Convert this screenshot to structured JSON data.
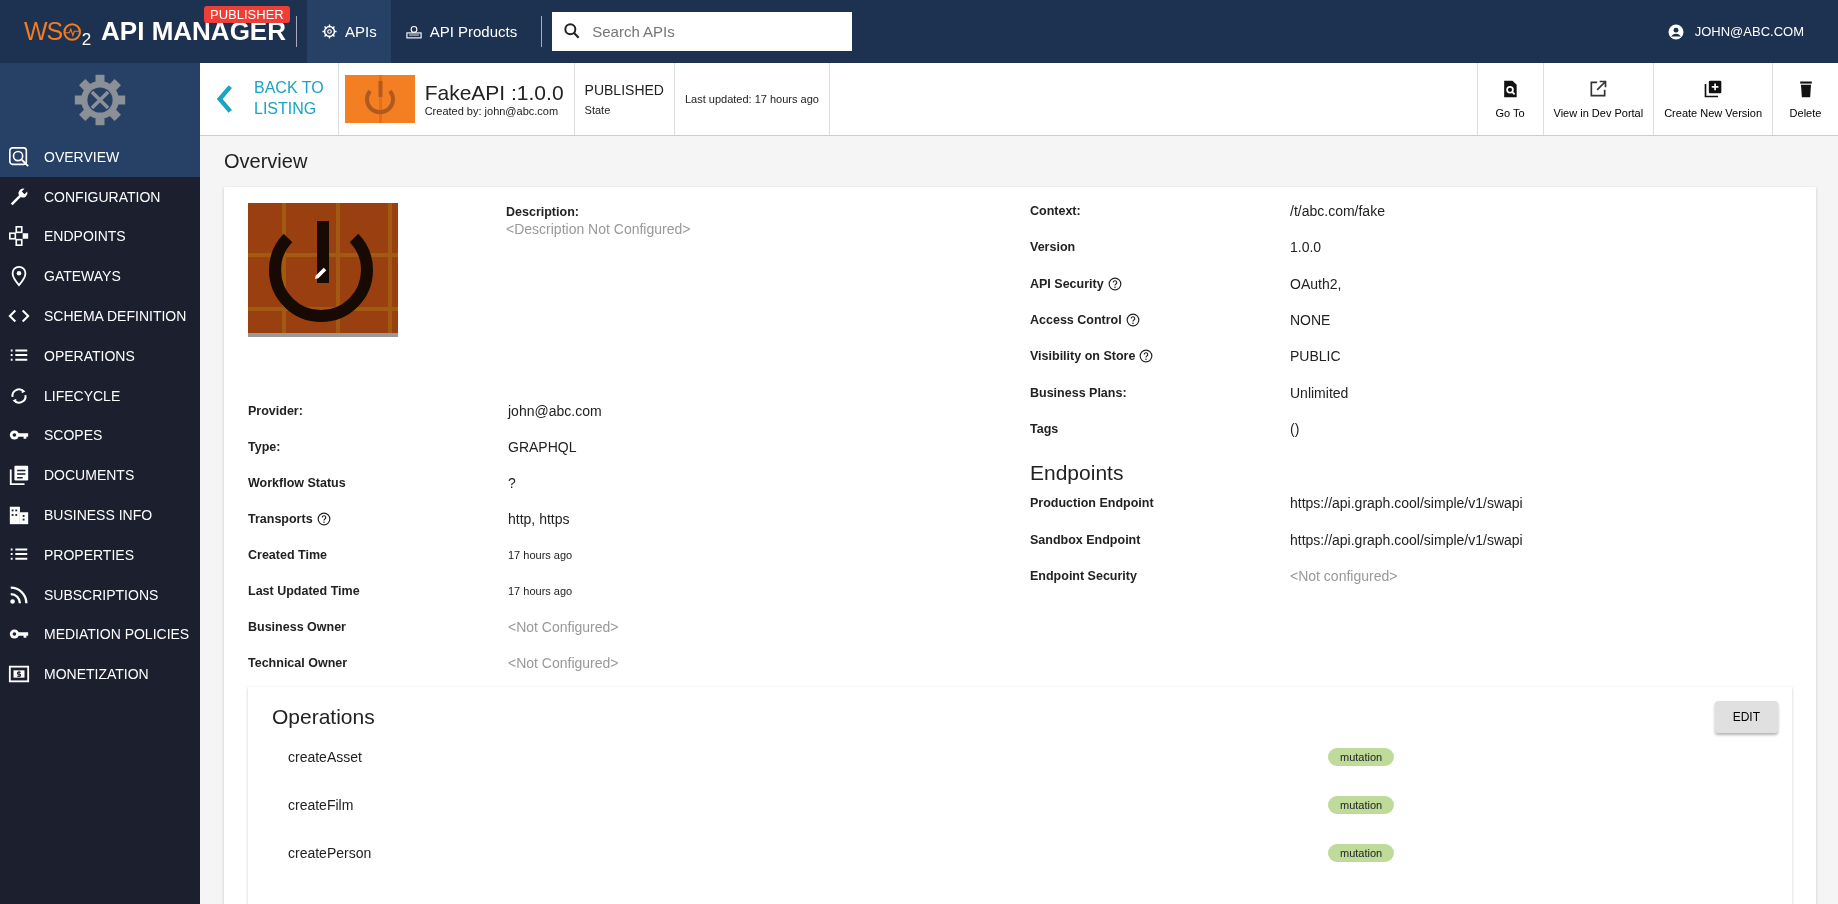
{
  "topbar": {
    "brand": {
      "prefix": "WS",
      "suffix": "2",
      "name": "API MANAGER",
      "badge": "PUBLISHER"
    },
    "nav": [
      {
        "label": "APIs",
        "selected": true
      },
      {
        "label": "API Products",
        "selected": false
      }
    ],
    "search": {
      "placeholder": "Search APIs"
    },
    "user": "JOHN@ABC.COM"
  },
  "sidebar": {
    "items": [
      {
        "label": "OVERVIEW",
        "selected": true
      },
      {
        "label": "CONFIGURATION",
        "selected": false
      },
      {
        "label": "ENDPOINTS",
        "selected": false
      },
      {
        "label": "GATEWAYS",
        "selected": false
      },
      {
        "label": "SCHEMA DEFINITION",
        "selected": false
      },
      {
        "label": "OPERATIONS",
        "selected": false
      },
      {
        "label": "LIFECYCLE",
        "selected": false
      },
      {
        "label": "SCOPES",
        "selected": false
      },
      {
        "label": "DOCUMENTS",
        "selected": false
      },
      {
        "label": "BUSINESS INFO",
        "selected": false
      },
      {
        "label": "PROPERTIES",
        "selected": false
      },
      {
        "label": "SUBSCRIPTIONS",
        "selected": false
      },
      {
        "label": "MEDIATION POLICIES",
        "selected": false
      },
      {
        "label": "MONETIZATION",
        "selected": false
      }
    ]
  },
  "header": {
    "back": [
      "BACK TO",
      "LISTING"
    ],
    "api_name": "FakeAPI :1.0.0",
    "created_by": "Created by: john@abc.com",
    "state": "PUBLISHED",
    "state_label": "State",
    "last_updated": "Last updated: 17 hours ago",
    "actions": [
      {
        "label": "Go To"
      },
      {
        "label": "View in Dev Portal"
      },
      {
        "label": "Create New Version"
      },
      {
        "label": "Delete"
      }
    ]
  },
  "overview": {
    "title": "Overview",
    "description": {
      "label": "Description:",
      "value": "<Description Not Configured>"
    },
    "left_rows": [
      {
        "label": "Provider:",
        "value": "john@abc.com",
        "help": false,
        "kind": "text"
      },
      {
        "label": "Type:",
        "value": "GRAPHQL",
        "help": false,
        "kind": "text"
      },
      {
        "label": "Workflow Status",
        "value": "?",
        "help": false,
        "kind": "text"
      },
      {
        "label": "Transports",
        "value": "http, https",
        "help": true,
        "kind": "text"
      },
      {
        "label": "Created Time",
        "value": "17 hours ago",
        "help": false,
        "kind": "small"
      },
      {
        "label": "Last Updated Time",
        "value": "17 hours ago",
        "help": false,
        "kind": "small"
      },
      {
        "label": "Business Owner",
        "value": "<Not Configured>",
        "help": false,
        "kind": "muted"
      },
      {
        "label": "Technical Owner",
        "value": "<Not Configured>",
        "help": false,
        "kind": "muted"
      }
    ],
    "right_rows": [
      {
        "label": "Context:",
        "value": "/t/abc.com/fake",
        "help": false,
        "kind": "text"
      },
      {
        "label": "Version",
        "value": "1.0.0",
        "help": false,
        "kind": "text"
      },
      {
        "label": "API Security",
        "value": "OAuth2,",
        "help": true,
        "kind": "text"
      },
      {
        "label": "Access Control",
        "value": "NONE",
        "help": true,
        "kind": "text"
      },
      {
        "label": "Visibility on Store",
        "value": "PUBLIC",
        "help": true,
        "kind": "text"
      },
      {
        "label": "Business Plans:",
        "value": "Unlimited",
        "help": false,
        "kind": "text"
      },
      {
        "label": "Tags",
        "value": "()",
        "help": false,
        "kind": "text"
      }
    ],
    "endpoints": {
      "title": "Endpoints",
      "rows": [
        {
          "label": "Production Endpoint",
          "value": "https://api.graph.cool/simple/v1/swapi",
          "help": false,
          "kind": "text"
        },
        {
          "label": "Sandbox Endpoint",
          "value": "https://api.graph.cool/simple/v1/swapi",
          "help": false,
          "kind": "text"
        },
        {
          "label": "Endpoint Security",
          "value": "<Not configured>",
          "help": false,
          "kind": "muted"
        }
      ]
    }
  },
  "operations": {
    "title": "Operations",
    "edit": "EDIT",
    "items": [
      {
        "name": "createAsset",
        "type": "mutation"
      },
      {
        "name": "createFilm",
        "type": "mutation"
      },
      {
        "name": "createPerson",
        "type": "mutation"
      }
    ]
  }
}
